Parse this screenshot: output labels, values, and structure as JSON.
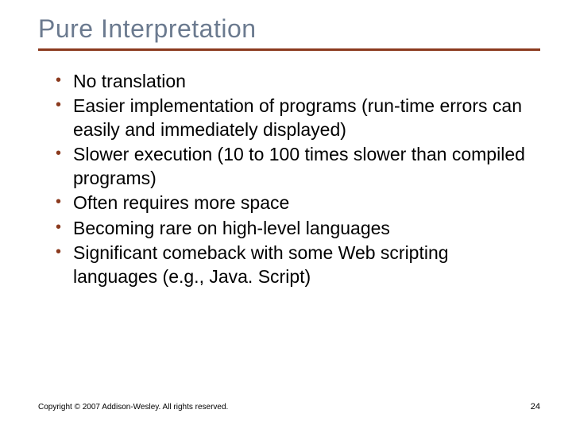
{
  "title": "Pure Interpretation",
  "bullets": [
    "No translation",
    "Easier implementation of programs (run-time errors can easily and immediately displayed)",
    "Slower execution (10 to 100 times slower than compiled programs)",
    "Often requires more space",
    "Becoming rare on high-level languages",
    "Significant comeback with some Web scripting languages (e.g., Java. Script)"
  ],
  "footer": {
    "copyright": "Copyright © 2007 Addison-Wesley. All rights reserved.",
    "page": "24"
  }
}
